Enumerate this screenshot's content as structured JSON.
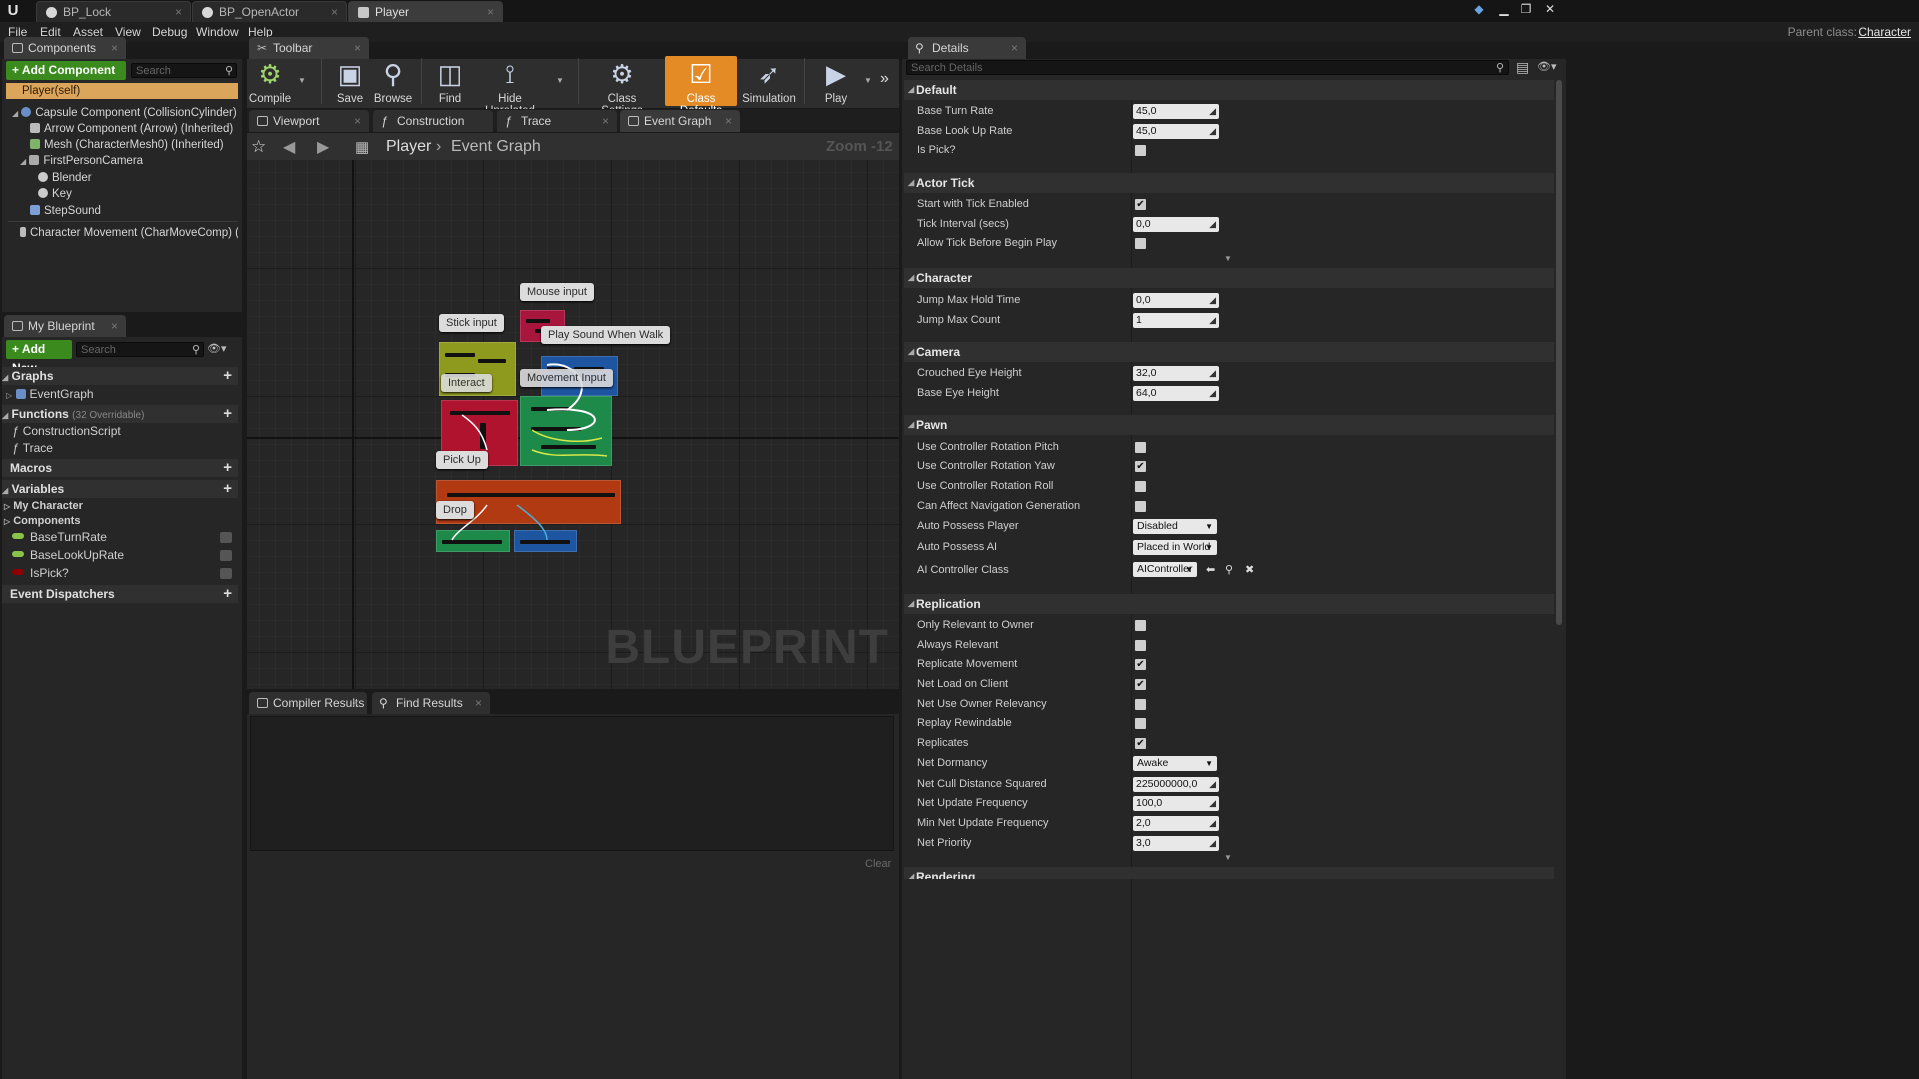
{
  "doc_tabs": [
    {
      "label": "BP_Lock"
    },
    {
      "label": "BP_OpenActor"
    },
    {
      "label": "Player"
    }
  ],
  "menu": [
    "File",
    "Edit",
    "Asset",
    "View",
    "Debug",
    "Window",
    "Help"
  ],
  "parent_class": {
    "label": "Parent class:",
    "value": "Character"
  },
  "components_panel": {
    "title": "Components",
    "add_button": "+ Add Component",
    "search_placeholder": "Search",
    "self_row": "Player(self)",
    "tree": [
      "Capsule Component (CollisionCylinder) (Inheri",
      "Arrow Component (Arrow) (Inherited)",
      "Mesh (CharacterMesh0) (Inherited)",
      "FirstPersonCamera",
      "Blender",
      "Key",
      "StepSound",
      "Character Movement (CharMoveComp) (Inheri"
    ]
  },
  "my_blueprint": {
    "title": "My Blueprint",
    "add_button": "+ Add New",
    "search_placeholder": "Search",
    "graphs_label": "Graphs",
    "event_graph": "EventGraph",
    "functions_label": "Functions",
    "functions_count": "(32 Overridable)",
    "functions": [
      "ConstructionScript",
      "Trace"
    ],
    "macros_label": "Macros",
    "variables_label": "Variables",
    "var_groups": [
      "My Character",
      "Components"
    ],
    "variables": [
      "BaseTurnRate",
      "BaseLookUpRate",
      "IsPick?"
    ],
    "event_dispatchers": "Event Dispatchers",
    "colors": {
      "float": "#8bc24a",
      "bool": "#8c0000"
    }
  },
  "toolbar": {
    "title": "Toolbar",
    "buttons": [
      "Compile",
      "Save",
      "Browse",
      "Find",
      "Hide Unrelated",
      "Class Settings",
      "Class Defaults",
      "Simulation",
      "Play"
    ]
  },
  "editor_tabs": [
    "Viewport",
    "Construction Scrip",
    "Trace",
    "Event Graph"
  ],
  "graph": {
    "breadcrumb_root": "Player",
    "breadcrumb_leaf": "Event Graph",
    "zoom": "Zoom -12",
    "watermark": "BLUEPRINT",
    "comments": [
      "Mouse input",
      "Stick input",
      "Play Sound When Walk",
      "Interact",
      "Movement Input",
      "Pick Up",
      "Drop"
    ]
  },
  "bottom_panel": {
    "tabs": [
      "Compiler Results",
      "Find Results"
    ],
    "clear": "Clear"
  },
  "details": {
    "title": "Details",
    "search_placeholder": "Search Details",
    "categories": {
      "default": "Default",
      "actor_tick": "Actor Tick",
      "character": "Character",
      "camera": "Camera",
      "pawn": "Pawn",
      "replication": "Replication",
      "rendering": "Rendering"
    },
    "props": {
      "base_turn_rate": {
        "label": "Base Turn Rate",
        "value": "45,0"
      },
      "base_look_up_rate": {
        "label": "Base Look Up Rate",
        "value": "45,0"
      },
      "is_pick": {
        "label": "Is Pick?",
        "checked": false
      },
      "start_tick": {
        "label": "Start with Tick Enabled",
        "checked": true
      },
      "tick_interval": {
        "label": "Tick Interval (secs)",
        "value": "0,0"
      },
      "allow_tick": {
        "label": "Allow Tick Before Begin Play",
        "checked": false
      },
      "jump_hold": {
        "label": "Jump Max Hold Time",
        "value": "0,0"
      },
      "jump_count": {
        "label": "Jump Max Count",
        "value": "1"
      },
      "crouched_eye": {
        "label": "Crouched Eye Height",
        "value": "32,0"
      },
      "base_eye": {
        "label": "Base Eye Height",
        "value": "64,0"
      },
      "rot_pitch": {
        "label": "Use Controller Rotation Pitch",
        "checked": false
      },
      "rot_yaw": {
        "label": "Use Controller Rotation Yaw",
        "checked": true
      },
      "rot_roll": {
        "label": "Use Controller Rotation Roll",
        "checked": false
      },
      "nav_gen": {
        "label": "Can Affect Navigation Generation",
        "checked": false
      },
      "auto_player": {
        "label": "Auto Possess Player",
        "value": "Disabled"
      },
      "auto_ai": {
        "label": "Auto Possess AI",
        "value": "Placed in World"
      },
      "ai_class": {
        "label": "AI Controller Class",
        "value": "AIController"
      },
      "only_owner": {
        "label": "Only Relevant to Owner",
        "checked": false
      },
      "always_rel": {
        "label": "Always Relevant",
        "checked": false
      },
      "rep_move": {
        "label": "Replicate Movement",
        "checked": true
      },
      "net_load": {
        "label": "Net Load on Client",
        "checked": true
      },
      "net_owner": {
        "label": "Net Use Owner Relevancy",
        "checked": false
      },
      "replay": {
        "label": "Replay Rewindable",
        "checked": false
      },
      "replicates": {
        "label": "Replicates",
        "checked": true
      },
      "dormancy": {
        "label": "Net Dormancy",
        "value": "Awake"
      },
      "cull": {
        "label": "Net Cull Distance Squared",
        "value": "225000000,0"
      },
      "update_freq": {
        "label": "Net Update Frequency",
        "value": "100,0"
      },
      "min_update": {
        "label": "Min Net Update Frequency",
        "value": "2,0"
      },
      "priority": {
        "label": "Net Priority",
        "value": "3,0"
      }
    }
  }
}
